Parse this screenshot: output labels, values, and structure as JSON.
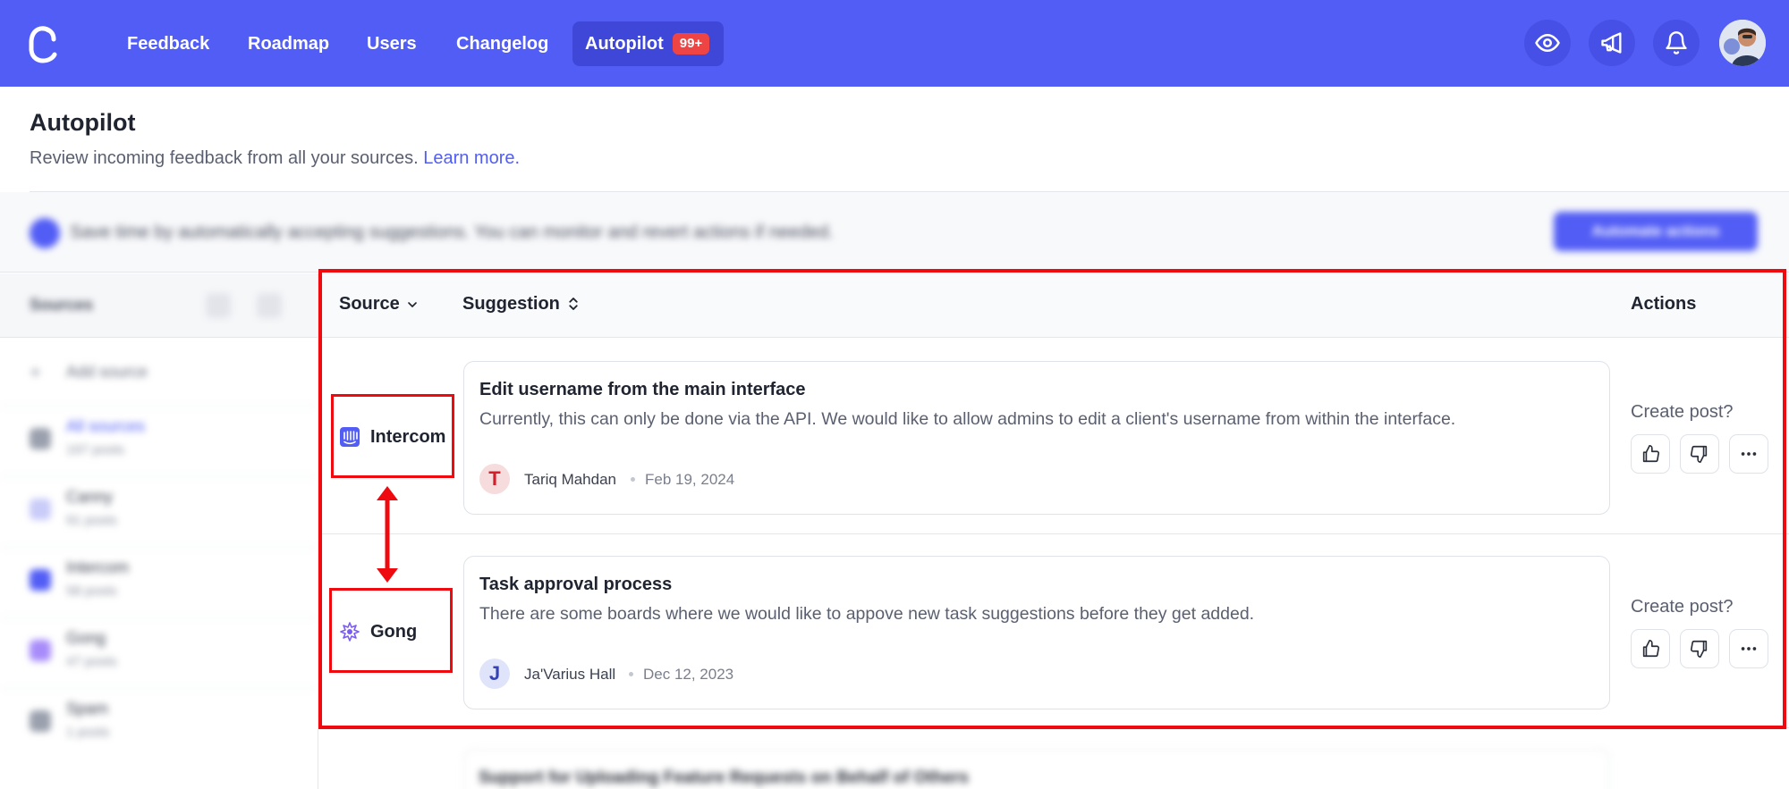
{
  "nav": {
    "links": [
      "Feedback",
      "Roadmap",
      "Users",
      "Changelog"
    ],
    "active_link": "Autopilot",
    "active_badge": "99+",
    "icons": [
      "eye-icon",
      "megaphone-icon",
      "bell-icon"
    ]
  },
  "header": {
    "title": "Autopilot",
    "subtitle": "Review incoming feedback from all your sources.",
    "learn_more": "Learn more."
  },
  "banner": {
    "text": "Save time by automatically accepting suggestions. You can monitor and revert actions if needed.",
    "button": "Automate actions"
  },
  "sidebar": {
    "title": "Sources",
    "add_source": "Add source",
    "items": [
      {
        "label": "All sources",
        "count": "197 posts",
        "icon": "inbox-icon",
        "color": "#9aa0ad"
      },
      {
        "label": "Canny",
        "count": "91 posts",
        "icon": "canny-icon",
        "color": "#c9cbf9"
      },
      {
        "label": "Intercom",
        "count": "58 posts",
        "icon": "intercom-icon",
        "color": "#525df5"
      },
      {
        "label": "Gong",
        "count": "47 posts",
        "icon": "gong-icon",
        "color": "#a78bfa"
      },
      {
        "label": "Spam",
        "count": "1 posts",
        "icon": "spam-icon",
        "color": "#9aa0ad"
      }
    ]
  },
  "table": {
    "col_source": "Source",
    "col_suggestion": "Suggestion",
    "col_actions": "Actions",
    "rows": [
      {
        "source": "Intercom",
        "title": "Edit username from the main interface",
        "body": "Currently, this can only be done via the API. We would like to allow admins to edit a client's username from within the interface.",
        "avatar_letter": "T",
        "author": "Tariq Mahdan",
        "date": "Feb 19, 2024",
        "action_prompt": "Create post?"
      },
      {
        "source": "Gong",
        "title": "Task approval process",
        "body": "There are some boards where we would like to appove new task suggestions before they get added.",
        "avatar_letter": "J",
        "author": "Ja'Varius Hall",
        "date": "Dec 12, 2023",
        "action_prompt": "Create post?"
      }
    ],
    "next_row_title": "Support for Uploading Feature Requests on Behalf of Others"
  },
  "colors": {
    "brand": "#525df5",
    "annotation": "#ef0a10",
    "badge": "#ef4444"
  }
}
